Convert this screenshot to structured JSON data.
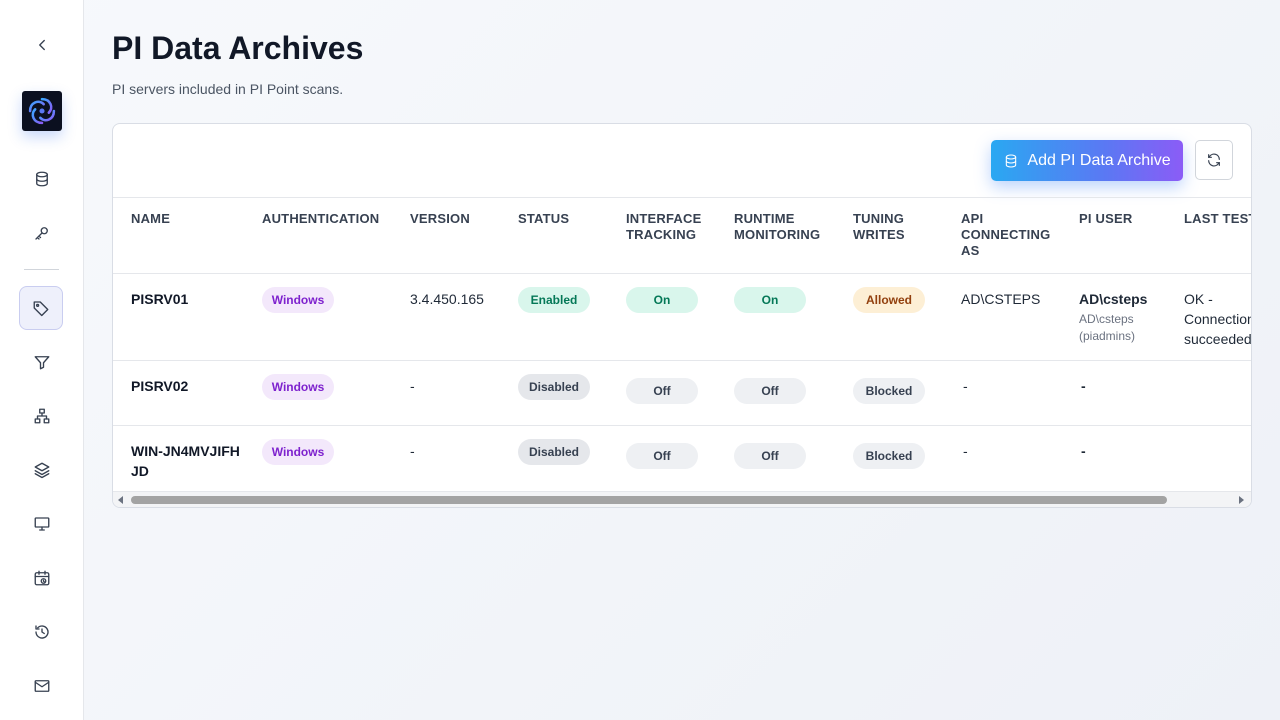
{
  "page": {
    "title": "PI Data Archives",
    "subtitle": "PI servers included in PI Point scans."
  },
  "sidebar": {
    "items": [
      {
        "icon": "chevron-left-icon"
      },
      {
        "icon": "logo"
      },
      {
        "icon": "database-icon"
      },
      {
        "icon": "key-icon"
      },
      {
        "icon": "tag-icon",
        "active": true
      },
      {
        "icon": "filter-icon"
      },
      {
        "icon": "hierarchy-icon"
      },
      {
        "icon": "layers-icon"
      },
      {
        "icon": "monitor-icon"
      },
      {
        "icon": "calendar-clock-icon"
      },
      {
        "icon": "history-icon"
      },
      {
        "icon": "mail-icon"
      }
    ]
  },
  "toolbar": {
    "add_label": "Add PI Data Archive",
    "add_icon": "database-icon",
    "refresh_icon": "refresh-icon"
  },
  "table": {
    "headers": {
      "name": "NAME",
      "authentication": "AUTHENTICATION",
      "version": "VERSION",
      "status": "STATUS",
      "interface_tracking": "INTERFACE TRACKING",
      "runtime_monitoring": "RUNTIME MONITORING",
      "tuning_writes": "TUNING WRITES",
      "api_connecting_as": "API CONNECTING AS",
      "pi_user": "PI USER",
      "last_test": "LAST TEST"
    },
    "rows": [
      {
        "name": "PISRV01",
        "authentication": "Windows",
        "version": "3.4.450.165",
        "status": "Enabled",
        "interface_tracking": "On",
        "runtime_monitoring": "On",
        "tuning_writes": "Allowed",
        "api_connecting_as": "AD\\CSTEPS",
        "pi_user": "AD\\csteps",
        "pi_user_detail": "AD\\csteps (piadmins)",
        "last_test": "OK - Connection succeeded"
      },
      {
        "name": "PISRV02",
        "authentication": "Windows",
        "version": "-",
        "status": "Disabled",
        "interface_tracking": "Off",
        "runtime_monitoring": "Off",
        "tuning_writes": "Blocked",
        "api_connecting_as": "-",
        "pi_user": "-",
        "pi_user_detail": "",
        "last_test": ""
      },
      {
        "name": "WIN-JN4MVJIFHJD",
        "authentication": "Windows",
        "version": "-",
        "status": "Disabled",
        "interface_tracking": "Off",
        "runtime_monitoring": "Off",
        "tuning_writes": "Blocked",
        "api_connecting_as": "-",
        "pi_user": "-",
        "pi_user_detail": "",
        "last_test": ""
      }
    ]
  },
  "colors": {
    "accent_gradient_start": "#2aa8f2",
    "accent_gradient_end": "#8b5cf6",
    "enabled_green": "#047857",
    "windows_purple": "#7e22ce",
    "allowed_amber": "#92400e"
  }
}
